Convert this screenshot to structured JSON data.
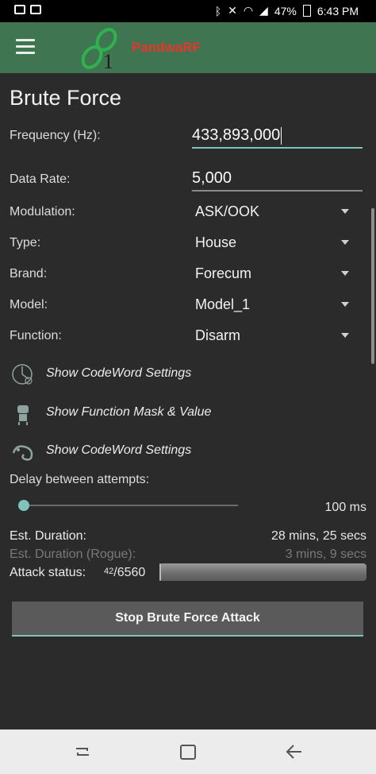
{
  "status_bar": {
    "battery": "47%",
    "time": "6:43 PM"
  },
  "app": {
    "brand": "PandwaRF",
    "logo_digit": "1"
  },
  "page": {
    "title": "Brute Force"
  },
  "form": {
    "frequency_label": "Frequency (Hz):",
    "frequency_value": "433,893,000",
    "data_rate_label": "Data Rate:",
    "data_rate_value": "5,000",
    "modulation_label": "Modulation:",
    "modulation_value": "ASK/OOK",
    "type_label": "Type:",
    "type_value": "House",
    "brand_label": "Brand:",
    "brand_value": "Forecum",
    "model_label": "Model:",
    "model_value": "Model_1",
    "function_label": "Function:",
    "function_value": "Disarm"
  },
  "settings": [
    {
      "label": "Show CodeWord Settings",
      "icon": "wheel-icon"
    },
    {
      "label": "Show Function Mask & Value",
      "icon": "robot-icon"
    },
    {
      "label": "Show CodeWord Settings",
      "icon": "chameleon-icon"
    }
  ],
  "delay": {
    "label": "Delay between attempts:",
    "value": "100 ms",
    "level": 0
  },
  "duration": {
    "label": "Est. Duration:",
    "value": "28 mins, 25 secs",
    "rogue_label": "Est. Duration (Rogue):",
    "rogue_value": "3 mins, 9 secs"
  },
  "attack": {
    "label": "Attack status:",
    "current": "42",
    "total": "/6560",
    "progress": 0.0064
  },
  "button": {
    "stop_label": "Stop Brute Force Attack"
  },
  "colors": {
    "appbar": "#3f7651",
    "accent": "#7ec4bd",
    "brand": "#e8342a",
    "background": "#2b2b2b"
  }
}
